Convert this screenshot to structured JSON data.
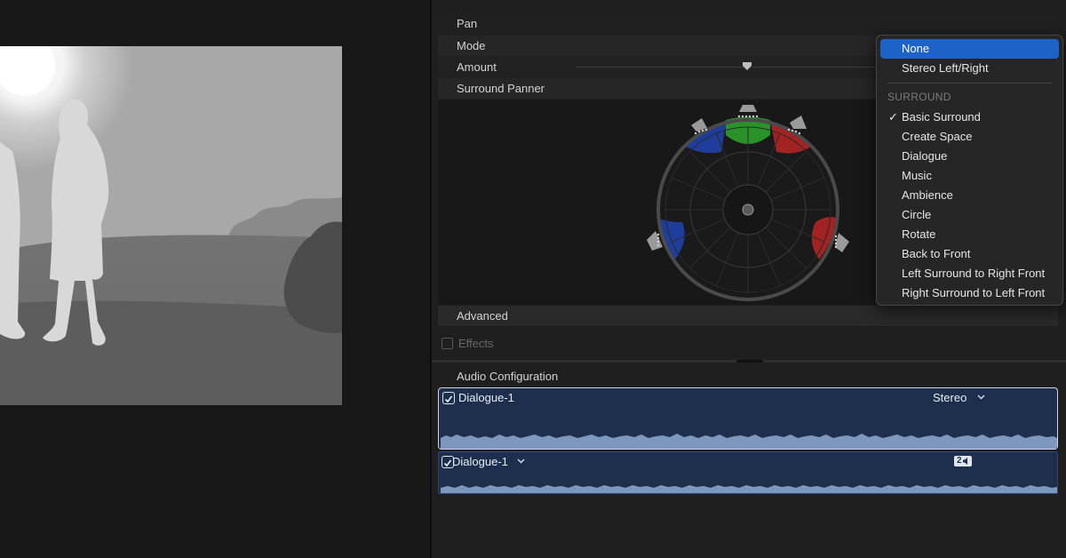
{
  "pan_section": {
    "title": "Pan",
    "mode_label": "Mode",
    "amount_label": "Amount",
    "surround_panner_label": "Surround Panner",
    "advanced_label": "Advanced"
  },
  "effects": {
    "label": "Effects",
    "checked": false
  },
  "mode_menu": {
    "items_top": [
      {
        "label": "None",
        "selected": true
      },
      {
        "label": "Stereo Left/Right",
        "selected": false
      }
    ],
    "section_header": "SURROUND",
    "check_glyph": "✓",
    "items_surround": [
      {
        "label": "Basic Surround",
        "checked": true
      },
      {
        "label": "Create Space",
        "checked": false
      },
      {
        "label": "Dialogue",
        "checked": false
      },
      {
        "label": "Music",
        "checked": false
      },
      {
        "label": "Ambience",
        "checked": false
      },
      {
        "label": "Circle",
        "checked": false
      },
      {
        "label": "Rotate",
        "checked": false
      },
      {
        "label": "Back to Front",
        "checked": false
      },
      {
        "label": "Left Surround to Right Front",
        "checked": false
      },
      {
        "label": "Right Surround to Left Front",
        "checked": false
      }
    ]
  },
  "audio_configuration": {
    "title": "Audio Configuration",
    "tracks": [
      {
        "name": "Dialogue-1",
        "channel": "Stereo",
        "checked": true
      },
      {
        "name": "Dialogue-1",
        "channel_badge": "2",
        "checked": true
      }
    ]
  },
  "colors": {
    "menu_highlight": "#1d62c7",
    "track_fill": "#1d2f4d",
    "waveform": "#7e97bd",
    "panner_green": "#2a9a2a",
    "panner_red": "#a32222",
    "panner_blue": "#1f3d9a"
  },
  "icons": [
    "checkmark-icon",
    "chevron-down-icon",
    "speaker-icon",
    "slider-thumb-icon",
    "stereo-badge-icon"
  ]
}
